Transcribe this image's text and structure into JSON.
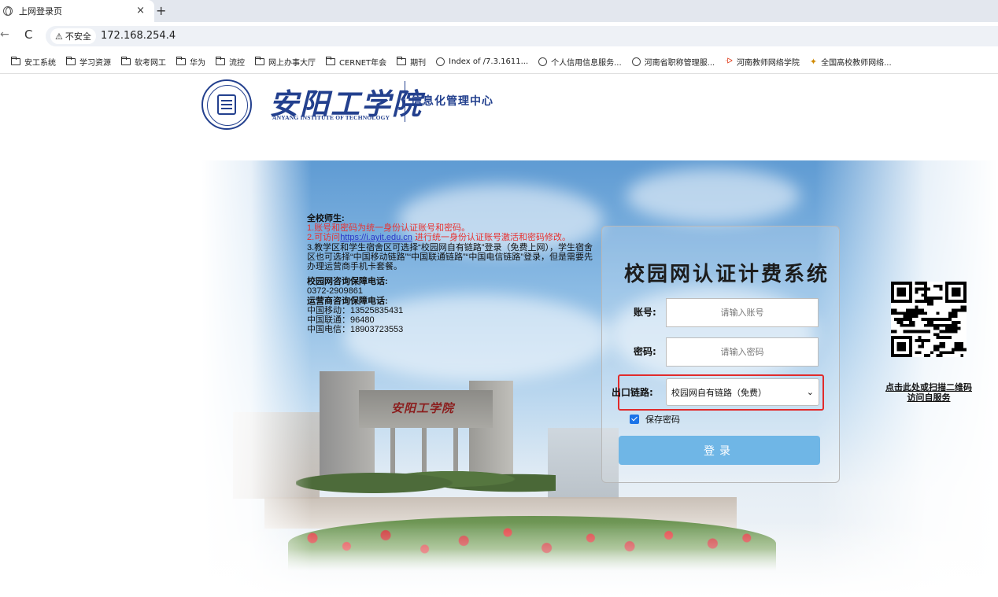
{
  "browser": {
    "tab_title": "上网登录页",
    "tab_close": "×",
    "new_tab": "+",
    "back_icon": "←",
    "reload_icon": "C",
    "security_warning": "不安全",
    "url": "172.168.254.4",
    "bookmarks": [
      {
        "label": "安工系统",
        "icon": "folder-icon"
      },
      {
        "label": "学习资源",
        "icon": "folder-icon"
      },
      {
        "label": "软考网工",
        "icon": "folder-icon"
      },
      {
        "label": "华为",
        "icon": "folder-icon"
      },
      {
        "label": "流控",
        "icon": "folder-icon"
      },
      {
        "label": "网上办事大厅",
        "icon": "folder-icon"
      },
      {
        "label": "CERNET年会",
        "icon": "folder-icon"
      },
      {
        "label": "期刊",
        "icon": "folder-icon"
      },
      {
        "label": "Index of /7.3.1611...",
        "icon": "globe-icon"
      },
      {
        "label": "个人信用信息服务...",
        "icon": "globe-icon"
      },
      {
        "label": "河南省职称管理服...",
        "icon": "globe-icon"
      },
      {
        "label": "河南教师网络学院",
        "icon": "flame-icon"
      },
      {
        "label": "全国高校教师网络...",
        "icon": "star-icon"
      }
    ]
  },
  "header": {
    "school_name_cn": "安阳工学院",
    "school_name_en": "ANYANG INSTITUTE OF TECHNOLOGY",
    "center_name": "信息化管理中心"
  },
  "notice": {
    "heading": "全校师生:",
    "line1": "1.账号和密码为统一身份认证账号和密码。",
    "line2_prefix": "2.可访问",
    "line2_link": "https://i.ayit.edu.cn",
    "line2_suffix": " 进行统一身份认证账号激活和密码修改。",
    "line3": "3.教学区和学生宿舍区可选择“校园网自有链路”登录（免费上网），学生宿舍区也可选择“中国移动链路”“中国联通链路”“中国电信链路”登录，但是需要先办理运营商手机卡套餐。",
    "campus_phone_label": "校园网咨询保障电话:",
    "campus_phone": "0372-2909861",
    "isp_phone_label": "运营商咨询保障电话:",
    "mobile": "中国移动：13525835431",
    "unicom": "中国联通：96480",
    "telecom": "中国电信：18903723553"
  },
  "gate_plaque": "安阳工学院",
  "login": {
    "title": "校园网认证计费系统",
    "account_label": "账号:",
    "account_placeholder": "请输入账号",
    "password_label": "密码:",
    "password_placeholder": "请输入密码",
    "exit_label": "出口链路:",
    "exit_selected": "校园网自有链路（免费）",
    "save_password_label": "保存密码",
    "save_password_checked": true,
    "submit_label": "登录"
  },
  "qr": {
    "caption_line1": "点击此处或扫描二维码",
    "caption_line2": "访问自服务"
  },
  "colors": {
    "brand_blue": "#23408e",
    "notice_red": "#e8312f",
    "login_button": "#6fb6e6",
    "highlight_red": "#e12b2b"
  }
}
